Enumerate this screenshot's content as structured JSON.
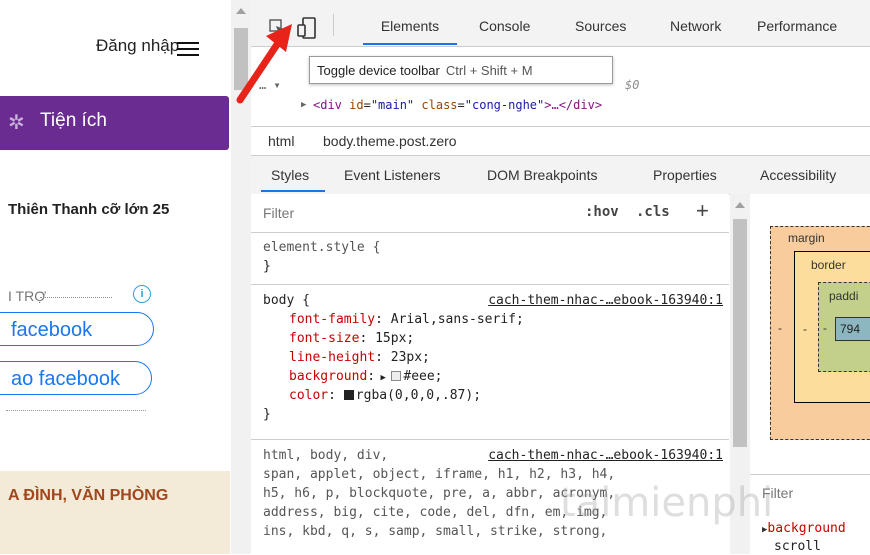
{
  "webpage": {
    "login": "Đăng nhập",
    "menu_button": "Tiện ích",
    "article_snippet": "Thiên Thanh cỡ lớn 25",
    "sponsor_label": "I TRỢ",
    "facebook_btn1": "facebook",
    "facebook_btn2": "ao facebook",
    "banner_text": "A ĐÌNH, VĂN PHÒNG"
  },
  "devtools": {
    "tabs": [
      "Elements",
      "Console",
      "Sources",
      "Network",
      "Performance"
    ],
    "active_tab": "Elements",
    "tooltip": {
      "label": "Toggle device toolbar",
      "shortcut": "Ctrl + Shift + M"
    },
    "dom_row1_dollar": "$0",
    "dom_row2": {
      "tag_open": "<div ",
      "attr1": "id",
      "val1": "\"main\"",
      "attr2": "class",
      "val2": "\"cong-nghe\"",
      "tail": ">…</div>"
    },
    "breadcrumbs": [
      "html",
      "body.theme.post.zero"
    ],
    "sub_tabs": [
      "Styles",
      "Event Listeners",
      "DOM Breakpoints",
      "Properties",
      "Accessibility"
    ],
    "filter_placeholder": "Filter",
    "hov": ":hov",
    "cls": ".cls",
    "plus": "+",
    "element_style": {
      "open": "element.style {",
      "close": "}"
    },
    "body_rule": {
      "selector": "body {",
      "source": "cach-them-nhac-…ebook-163940:1",
      "props": [
        {
          "name": "font-family",
          "value": "Arial,sans-serif;"
        },
        {
          "name": "font-size",
          "value": "15px;"
        },
        {
          "name": "line-height",
          "value": "23px;"
        },
        {
          "name": "background",
          "value": "#eee;"
        },
        {
          "name": "color",
          "value": "rgba(0,0,0,.87);"
        }
      ],
      "close": "}"
    },
    "reset_rule": {
      "source": "cach-them-nhac-…ebook-163940:1",
      "lines": [
        "html, body, div,",
        "span, applet, object, iframe, h1, h2, h3, h4,",
        "h5, h6, p, blockquote, pre, a, abbr, acronym,",
        "address, big, cite, code, del, dfn, em, img,",
        "ins, kbd, q, s, samp, small, strike, strong,"
      ]
    },
    "box_model": {
      "margin": "margin",
      "border": "border",
      "padding": "paddi",
      "content": "794",
      "dash": "-"
    },
    "computed": {
      "filter": "Filter",
      "property": "background",
      "value": "scroll"
    },
    "watermark": "taimienphi"
  },
  "colors": {
    "accent": "#1a73e8",
    "menu_bg": "#6b2c91",
    "arrow": "#e8231a",
    "facebook": "#1877f2"
  },
  "icons": [
    "inspect-element-icon",
    "device-toolbar-icon",
    "gear-flower-icon",
    "info-icon",
    "red-arrow-annotation"
  ]
}
